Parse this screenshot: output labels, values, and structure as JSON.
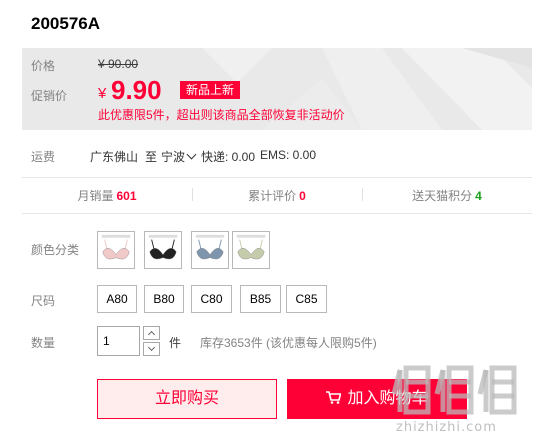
{
  "product": {
    "code": "200576A"
  },
  "price": {
    "original_label": "价格",
    "original_value": "¥ 90.00",
    "sale_label": "促销价",
    "sale_currency": "¥",
    "sale_value": "9.90",
    "badge": "新品上新",
    "promo_note": "此优惠限5件，超出则该商品全部恢复非活动价"
  },
  "shipping": {
    "label": "运费",
    "from": "广东佛山",
    "to_prefix": "至",
    "to": "宁波",
    "express": "快递: 0.00",
    "ems": "EMS: 0.00"
  },
  "stats": [
    {
      "label": "月销量",
      "value": "601",
      "color": "#ff0036"
    },
    {
      "label": "累计评价",
      "value": "0",
      "color": "#ff0036"
    },
    {
      "label": "送天猫积分",
      "value": "4",
      "color": "#1b9f1b"
    }
  ],
  "color_options": {
    "label": "颜色分类",
    "swatches": [
      {
        "name": "pink",
        "color": "#f2c9c9"
      },
      {
        "name": "black",
        "color": "#222222"
      },
      {
        "name": "blue",
        "color": "#7f95ad"
      },
      {
        "name": "green",
        "color": "#c5ccac"
      }
    ]
  },
  "size_options": {
    "label": "尺码",
    "sizes": [
      "A80",
      "B80",
      "C80",
      "B85",
      "C85"
    ]
  },
  "quantity": {
    "label": "数量",
    "value": "1",
    "unit": "件",
    "stock": "库存3653件",
    "limit_note": "(该优惠每人限购5件)"
  },
  "actions": {
    "buy_now": "立即购买",
    "add_to_cart": "加入购物车"
  },
  "watermark": {
    "text": "zhizhizhi.com",
    "color": "#aaaaaa"
  }
}
